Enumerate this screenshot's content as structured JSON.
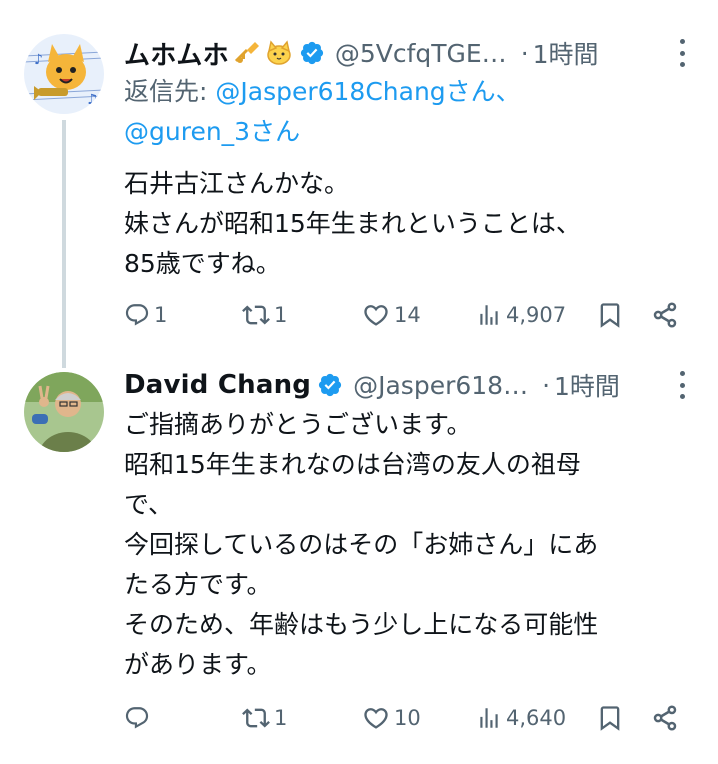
{
  "tweets": [
    {
      "name": "ムホムホ",
      "handle": "@5VcfqTGE…",
      "dot": "·",
      "time": "1時間",
      "reply_prefix": "返信先: ",
      "reply_mention_1": "@Jasper618Changさん、",
      "reply_mention_2": "@guren_3さん",
      "lines": [
        "石井古江さんかな。",
        "妹さんが昭和15年生まれということは、",
        "85歳ですね。"
      ],
      "replies": "1",
      "retweets": "1",
      "likes": "14",
      "views": "4,907"
    },
    {
      "name": "David Chang",
      "handle": "@Jasper618…",
      "dot": "·",
      "time": "1時間",
      "lines": [
        "ご指摘ありがとうございます。",
        "昭和15年生まれなのは台湾の友人の祖母",
        "で、",
        "今回探しているのはその「お姉さん」にあ",
        "たる方です。",
        "そのため、年齢はもう少し上になる可能性",
        "があります。"
      ],
      "replies": "",
      "retweets": "1",
      "likes": "10",
      "views": "4,640"
    }
  ],
  "colors": {
    "text": "#0f1419",
    "secondary": "#536471",
    "accent": "#1d9bf0",
    "thread_line": "#cfd9de"
  },
  "icons": [
    "reply-icon",
    "retweet-icon",
    "like-icon",
    "views-icon",
    "bookmark-icon",
    "share-icon",
    "verified-icon",
    "more-icon",
    "trumpet-emoji",
    "cat-face-emoji"
  ]
}
